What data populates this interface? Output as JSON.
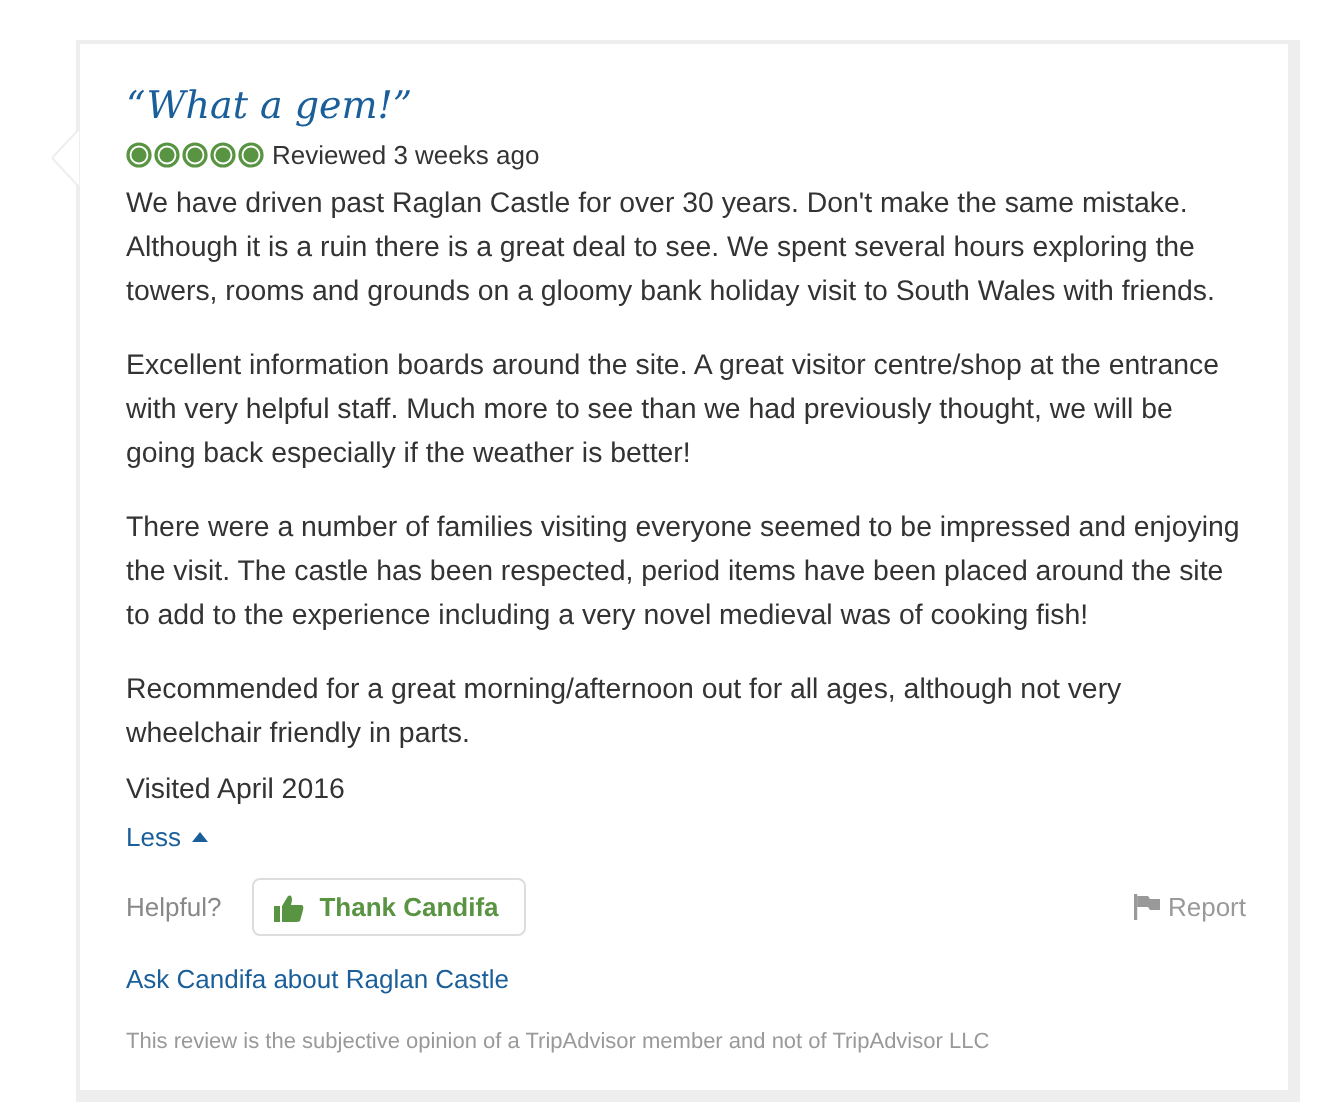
{
  "review": {
    "title": "“What a gem!”",
    "stars": 5,
    "date": "Reviewed 3 weeks ago",
    "paragraphs": [
      "We have driven past Raglan Castle for over 30 years. Don't make the same mistake. Although it is a ruin there is a great deal to see. We spent several hours exploring the towers, rooms and grounds on a gloomy bank holiday visit to South Wales with friends.",
      "Excellent information boards around the site. A great visitor centre/shop at the entrance with very helpful staff. Much more to see than we had previously thought, we will be going back especially if the weather is better!",
      "There were a number of families visiting everyone seemed to be impressed and enjoying the visit. The castle has been respected, period items have been placed around the site to add to the experience including a very novel medieval was of cooking fish!",
      "Recommended for a great morning/afternoon out for all ages, although not very wheelchair friendly in parts."
    ],
    "visited": "Visited April 2016",
    "less_link": "Less",
    "helpful_label": "Helpful?",
    "thank_button": "Thank Candifa",
    "report_link": "Report",
    "ask_link": "Ask Candifa about Raglan Castle",
    "disclaimer": "This review is the subjective opinion of a TripAdvisor member and not of TripAdvisor LLC"
  }
}
